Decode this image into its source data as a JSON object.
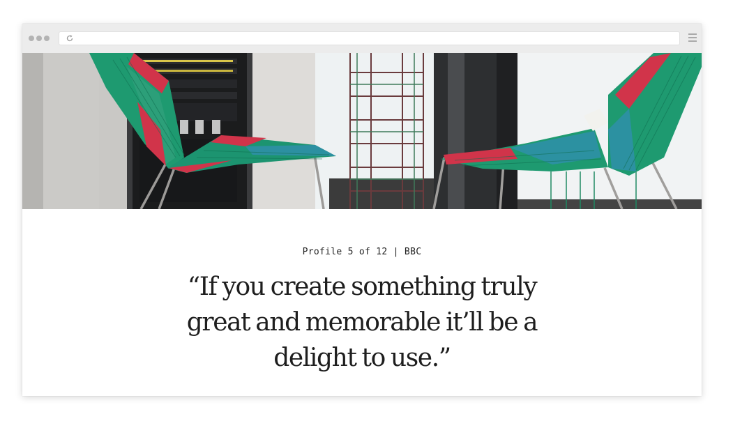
{
  "browser": {
    "icons": {
      "reload": "reload-icon",
      "menu": "hamburger-menu-icon"
    }
  },
  "hero": {
    "image": "photo of two green and red woven outdoor chairs facing each other beside a server rack and a wire rack",
    "colors": {
      "chair_green": "#1e9a70",
      "chair_red": "#d1344a",
      "chair_blue": "#2f8fa9"
    }
  },
  "profile": {
    "eyebrow": "Profile 5 of 12 | BBC",
    "quote": "“If you create something truly great and memorable it’ll be a delight to use.”"
  }
}
